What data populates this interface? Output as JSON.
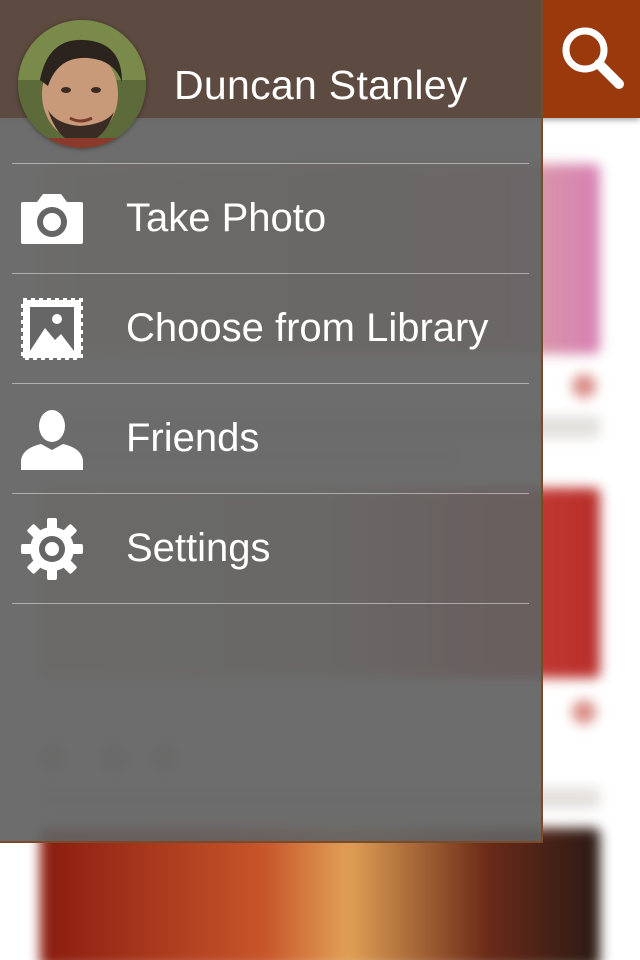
{
  "user": {
    "name": "Duncan Stanley"
  },
  "menu": {
    "items": [
      {
        "label": "Take Photo",
        "icon": "camera-icon"
      },
      {
        "label": "Choose from Library",
        "icon": "photo-library-icon"
      },
      {
        "label": "Friends",
        "icon": "person-icon"
      },
      {
        "label": "Settings",
        "icon": "gear-icon"
      }
    ]
  },
  "header": {
    "search_icon": "search-icon"
  },
  "colors": {
    "accent": "#9a3a0c",
    "drawer_header": "#5d4a40",
    "drawer_bg": "#626262",
    "text": "#ffffff"
  }
}
